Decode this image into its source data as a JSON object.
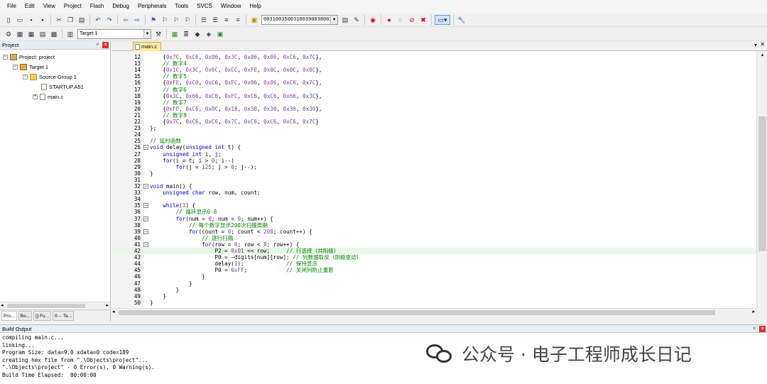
{
  "menu": [
    "File",
    "Edit",
    "View",
    "Project",
    "Flash",
    "Debug",
    "Peripherals",
    "Tools",
    "SVCS",
    "Window",
    "Help"
  ],
  "toolbar": {
    "address_value": "00310035003100390038003",
    "target_value": "Target 1"
  },
  "project_panel": {
    "title": "Project",
    "tree": {
      "root": "Project: project",
      "target": "Target 1",
      "group": "Source Group 1",
      "files": [
        "STARTUP.A51",
        "main.c"
      ]
    },
    "tabs": [
      "Pro...",
      "Bo...",
      "{} Fu...",
      "0→ Te..."
    ]
  },
  "editor": {
    "active_tab": "main.c",
    "current_line": 42,
    "lines": [
      {
        "n": "12",
        "t": "    {0x7C, 0xC6, 0x06, 0x3C, 0x06, 0x06, 0xC6, 0x7C},"
      },
      {
        "n": "13",
        "t": "    // 数字4"
      },
      {
        "n": "14",
        "t": "    {0x1C, 0x3C, 0x6C, 0xCC, 0xFE, 0x0C, 0x0C, 0x0C},"
      },
      {
        "n": "15",
        "t": "    // 数字5"
      },
      {
        "n": "16",
        "t": "    {0xFE, 0xC0, 0xC0, 0xFC, 0x06, 0x06, 0xC6, 0x7C},"
      },
      {
        "n": "17",
        "t": "    // 数字6"
      },
      {
        "n": "18",
        "t": "    {0x3C, 0x66, 0xC0, 0xFC, 0xC6, 0xC6, 0x66, 0x3C},"
      },
      {
        "n": "19",
        "t": "    // 数字7"
      },
      {
        "n": "20",
        "t": "    {0xFE, 0xC6, 0x0C, 0x18, 0x30, 0x30, 0x30, 0x30},"
      },
      {
        "n": "21",
        "t": "    // 数字8"
      },
      {
        "n": "22",
        "t": "    {0x7C, 0xC6, 0xC6, 0x7C, 0xC6, 0xC6, 0xC6, 0x7C}"
      },
      {
        "n": "23",
        "t": "};"
      },
      {
        "n": "24",
        "t": ""
      },
      {
        "n": "25",
        "t": "// 延时函数"
      },
      {
        "n": "26",
        "t": "void delay(unsigned int t) {"
      },
      {
        "n": "27",
        "t": "    unsigned int i, j;"
      },
      {
        "n": "28",
        "t": "    for(i = t; i > 0; i--)"
      },
      {
        "n": "29",
        "t": "        for(j = 125; j > 0; j--);"
      },
      {
        "n": "30",
        "t": "}"
      },
      {
        "n": "31",
        "t": ""
      },
      {
        "n": "32",
        "t": "void main() {"
      },
      {
        "n": "33",
        "t": "    unsigned char row, num, count;"
      },
      {
        "n": "34",
        "t": ""
      },
      {
        "n": "35",
        "t": "    while(1) {"
      },
      {
        "n": "36",
        "t": "        // 循环显示0-8"
      },
      {
        "n": "37",
        "t": "        for(num = 0; num < 9; num++) {"
      },
      {
        "n": "38",
        "t": "            // 每个数字显示200次扫描周期"
      },
      {
        "n": "39",
        "t": "            for(count = 0; count < 200; count++) {"
      },
      {
        "n": "40",
        "t": "                // 逐行扫描"
      },
      {
        "n": "41",
        "t": "                for(row = 0; row < 8; row++) {"
      },
      {
        "n": "42",
        "t": "                    P2 = 0x01 << row;     // 行选择（共阳极）"
      },
      {
        "n": "43",
        "t": "                    P0 = ~digits[num][row]; // 列数据取反（阴极驱动）"
      },
      {
        "n": "44",
        "t": "                    delay(1);             // 保持显示"
      },
      {
        "n": "45",
        "t": "                    P0 = 0xFF;            // 关闭列防止重影"
      },
      {
        "n": "46",
        "t": "                }"
      },
      {
        "n": "47",
        "t": "            }"
      },
      {
        "n": "48",
        "t": "        }"
      },
      {
        "n": "49",
        "t": "    }"
      },
      {
        "n": "50",
        "t": "}"
      }
    ]
  },
  "build_output": {
    "title": "Build Output",
    "lines": [
      "compiling main.c...",
      "linking...",
      "Program Size: data=9.0 xdata=0 code=189",
      "creating hex file from \".\\Objects\\project\"...",
      "\".\\Objects\\project\" - 0 Error(s), 0 Warning(s).",
      "Build Time Elapsed:  00:00:00"
    ]
  },
  "watermark": "公众号 · 电子工程师成长日记"
}
